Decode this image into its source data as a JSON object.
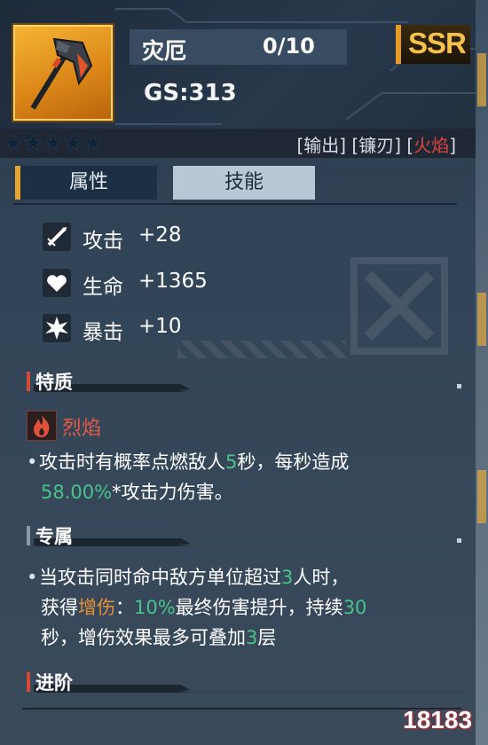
{
  "item": {
    "name": "灾厄",
    "level": "0/10",
    "gs": "GS:313",
    "rarity": "SSR",
    "stars": "★★★★★",
    "tags": {
      "t1": "[输出]",
      "t2": "[镰刃]",
      "t3_open": "[",
      "t3": "火焰",
      "t3_close": "]"
    }
  },
  "tabs": {
    "attributes": "属性",
    "skills": "技能"
  },
  "stats": [
    {
      "icon": "dagger-icon",
      "label": "攻击",
      "value": "+28"
    },
    {
      "icon": "heart-icon",
      "label": "生命",
      "value": "+1365"
    },
    {
      "icon": "burst-icon",
      "label": "暴击",
      "value": "+10"
    }
  ],
  "sections": {
    "trait": "特质",
    "exclusive": "专属",
    "advance": "进阶"
  },
  "trait": {
    "icon": "flame-icon",
    "name": "烈焰",
    "desc": {
      "p1": "攻击时有概率点燃敌人",
      "v1": "5",
      "p2": "秒，每秒造成",
      "v2": "58.00%",
      "p3": "*攻击力伤害。"
    }
  },
  "exclusive": {
    "p1": "当攻击同时命中敌方单位超过",
    "v1": "3",
    "p2": "人时，",
    "p3": "获得",
    "buff": "增伤",
    "p4": "：",
    "v2": "10%",
    "p5": "最终伤害提升，持续",
    "v3": "30",
    "p6": "秒，增伤效果最多可叠加",
    "v4": "3",
    "p7": "层"
  },
  "watermark": "18183",
  "colors": {
    "highlight": "#47c48b",
    "fire": "#e65a42",
    "rarity": "#f7c24b",
    "accent": "#e8a42d"
  }
}
